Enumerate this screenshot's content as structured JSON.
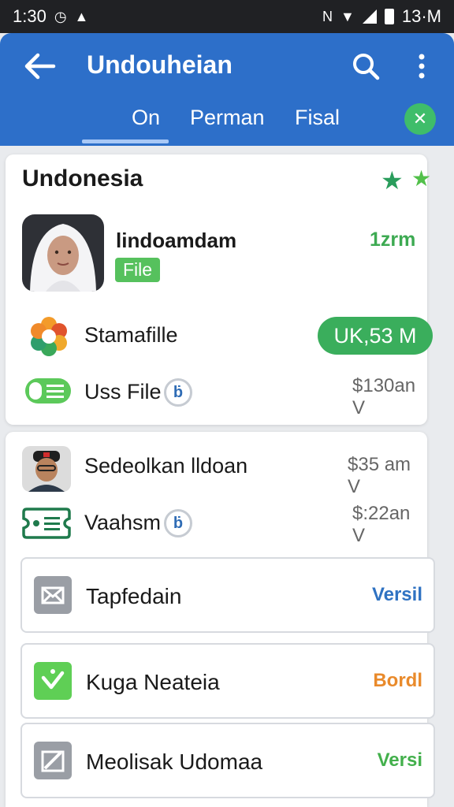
{
  "status_bar": {
    "time": "1:30",
    "right_text": "13·M"
  },
  "app_bar": {
    "title": "Undouheian",
    "tabs": [
      {
        "label": "On"
      },
      {
        "label": "Perman"
      },
      {
        "label": "Fisal"
      }
    ],
    "close_glyph": "✕"
  },
  "section_1": {
    "title": "Undonesia",
    "user": {
      "name": "lindoamdam",
      "badge": "File",
      "time": "1zrm"
    },
    "rows": [
      {
        "label": "Stamafille",
        "amount": "UK,53 M"
      },
      {
        "label": "Uss File",
        "price": "$130an V",
        "info_glyph": "ḃ"
      }
    ]
  },
  "section_2": {
    "rows": [
      {
        "label": "Sedeolkan lldoan",
        "price": "$35 am V"
      },
      {
        "label": "Vaahsm",
        "price": "$:22an V",
        "info_glyph": "ḃ"
      }
    ],
    "items": [
      {
        "label": "Tapfedain",
        "action": "Versil",
        "action_color": "#2f72c2",
        "icon_color": "#9a9ea5"
      },
      {
        "label": "Kuga Neateia",
        "action": "Bordl",
        "action_color": "#e98a2b",
        "icon_color": "#5fcf55"
      },
      {
        "label": "Meolisak Udomaa",
        "action": "Versi",
        "action_color": "#43b04c",
        "icon_color": "#9a9ea5"
      }
    ]
  },
  "icons": {
    "back": "arrow-left-icon",
    "search": "search-icon",
    "more": "more-vert-icon",
    "close": "close-icon",
    "star": "star-icon",
    "flower": "flower-icon",
    "toggle": "toggle-icon",
    "ticket": "ticket-icon",
    "mail": "mail-icon",
    "check": "check-icon",
    "edit": "edit-icon"
  },
  "colors": {
    "app_bar": "#2d6fc9",
    "accent_green": "#3aae5c",
    "status_bar": "#202124"
  }
}
